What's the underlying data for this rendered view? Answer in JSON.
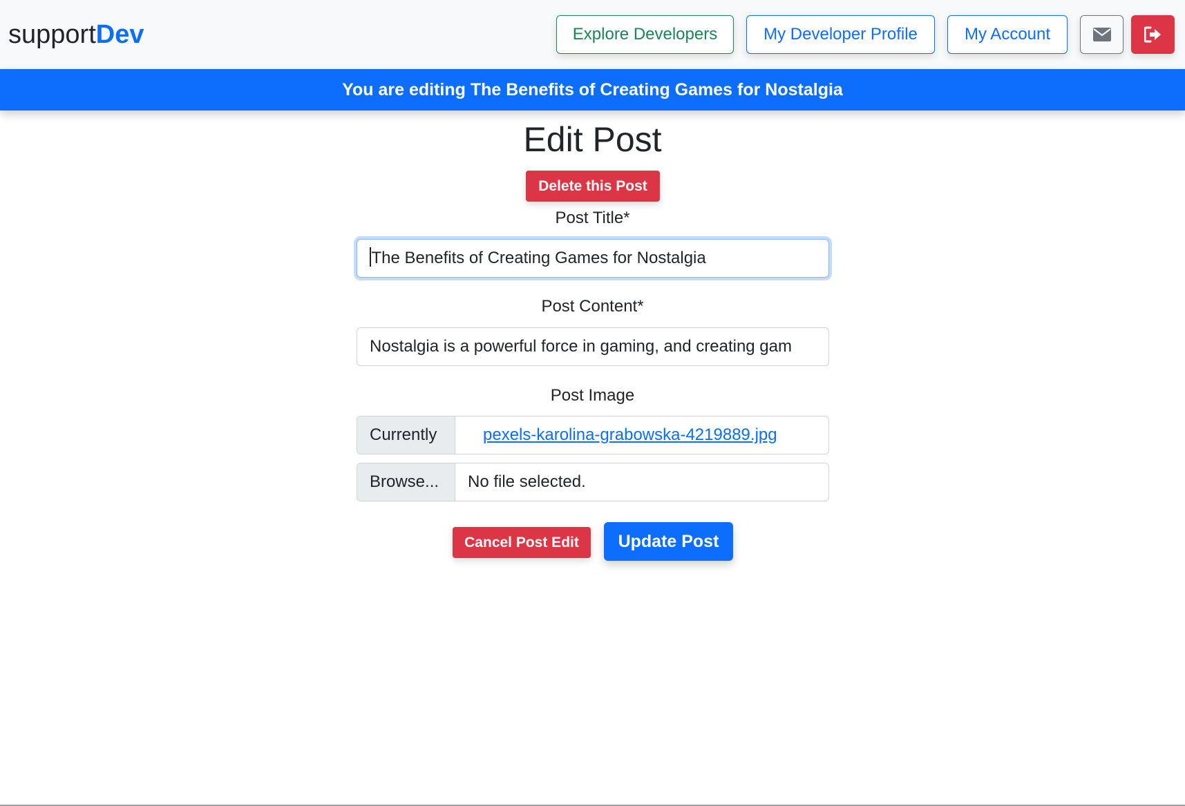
{
  "navbar": {
    "brand_prefix": "support",
    "brand_accent": "Dev",
    "explore_label": "Explore Developers",
    "profile_label": "My Developer Profile",
    "account_label": "My Account",
    "mail_icon": "envelope-icon",
    "logout_icon": "sign-out-icon"
  },
  "banner": {
    "text": "You are editing The Benefits of Creating Games for Nostalgia"
  },
  "main": {
    "title": "Edit Post",
    "delete_label": "Delete this Post",
    "post_title_label": "Post Title*",
    "post_title_value": "The Benefits of Creating Games for Nostalgia",
    "post_content_label": "Post Content*",
    "post_content_value": "Nostalgia is a powerful force in gaming, and creating gam",
    "post_image_label": "Post Image",
    "currently_label": "Currently",
    "current_file": "pexels-karolina-grabowska-4219889.jpg",
    "browse_label": "Browse...",
    "no_file_text": "No file selected.",
    "cancel_label": "Cancel Post Edit",
    "update_label": "Update Post"
  },
  "colors": {
    "primary": "#0d6efd",
    "danger": "#dc3545",
    "success": "#198754",
    "secondary": "#6c757d"
  }
}
